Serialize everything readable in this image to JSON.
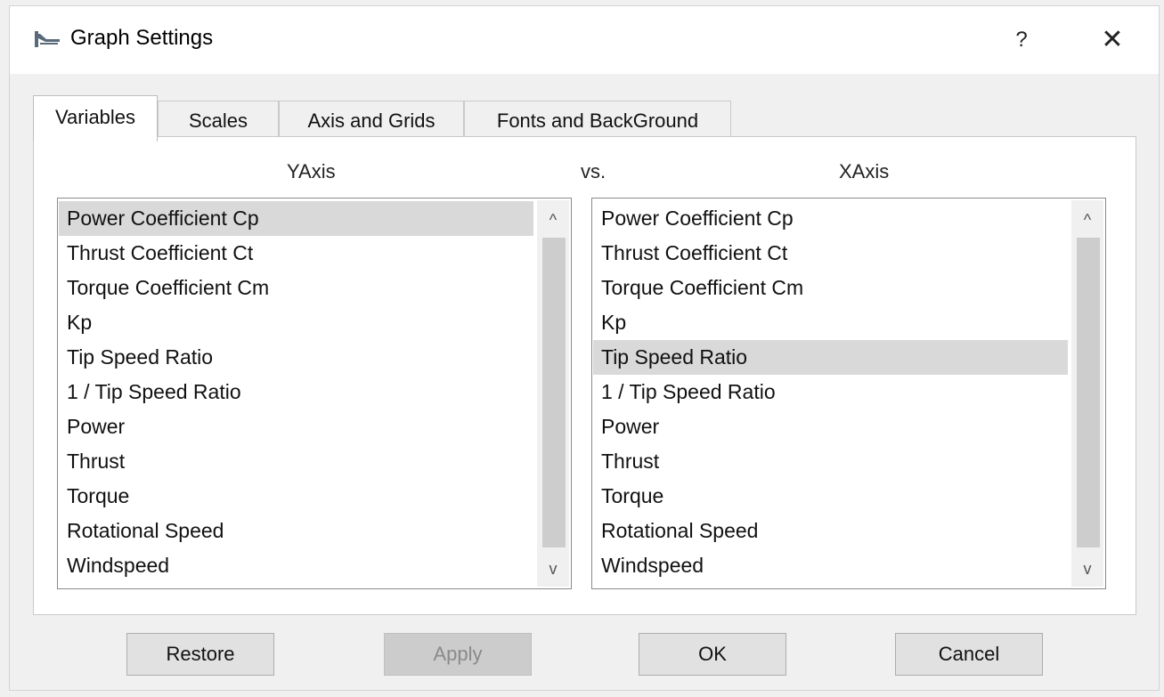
{
  "window": {
    "title": "Graph Settings",
    "help_label": "?",
    "close_label": "✕"
  },
  "tabs": [
    {
      "label": "Variables",
      "active": true
    },
    {
      "label": "Scales",
      "active": false
    },
    {
      "label": "Axis and Grids",
      "active": false
    },
    {
      "label": "Fonts and BackGround",
      "active": false
    }
  ],
  "variables": {
    "yaxis_label": "YAxis",
    "vs_label": "vs.",
    "xaxis_label": "XAxis",
    "y_list": {
      "items": [
        "Power Coefficient Cp",
        "Thrust Coefficient Ct",
        "Torque Coefficient Cm",
        "Kp",
        "Tip Speed Ratio",
        "1 / Tip Speed Ratio",
        "Power",
        "Thrust",
        "Torque",
        "Rotational Speed",
        "Windspeed"
      ],
      "selected": "Power Coefficient Cp"
    },
    "x_list": {
      "items": [
        "Power Coefficient Cp",
        "Thrust Coefficient Ct",
        "Torque Coefficient Cm",
        "Kp",
        "Tip Speed Ratio",
        "1 / Tip Speed Ratio",
        "Power",
        "Thrust",
        "Torque",
        "Rotational Speed",
        "Windspeed"
      ],
      "selected": "Tip Speed Ratio"
    },
    "scroll_up_glyph": "^",
    "scroll_down_glyph": "v"
  },
  "buttons": {
    "restore": "Restore",
    "apply": "Apply",
    "ok": "OK",
    "cancel": "Cancel"
  },
  "icons": {
    "app": "graph-app-icon",
    "scroll_up": "chevron-up-icon",
    "scroll_down": "chevron-down-icon"
  },
  "colors": {
    "selection": "#d9d9d9",
    "dialog_bg": "#f0f0f0",
    "disabled_button": "#cccccc"
  }
}
